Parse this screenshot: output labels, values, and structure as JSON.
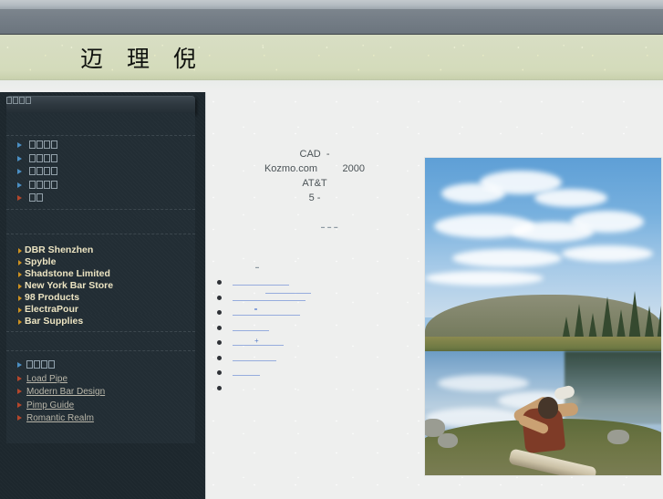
{
  "site": {
    "title": "迈 理 倪"
  },
  "sidebar": {
    "header_label_boxes": 4,
    "nav_top": [
      {
        "boxes": 4,
        "arrow": "blue"
      },
      {
        "boxes": 4,
        "arrow": "blue"
      },
      {
        "boxes": 4,
        "arrow": "blue"
      },
      {
        "boxes": 4,
        "arrow": "blue"
      },
      {
        "boxes": 2,
        "arrow": "red"
      }
    ],
    "brands": [
      "DBR Shenzhen",
      "Spyble",
      "Shadstone Limited",
      "New York Bar Store",
      "98 Products",
      "ElectraPour",
      "Bar Supplies"
    ],
    "links_header_boxes": 4,
    "links": [
      {
        "label": "",
        "boxes": 4,
        "arrow": "blue"
      },
      {
        "label": "Load Pipe",
        "boxes": 0,
        "arrow": "red"
      },
      {
        "label": "Modern Bar Design",
        "boxes": 0,
        "arrow": "red"
      },
      {
        "label": "Pimp Guide",
        "boxes": 0,
        "arrow": "red"
      },
      {
        "label": "Romantic Realm",
        "boxes": 0,
        "arrow": "red"
      }
    ]
  },
  "main": {
    "article_lines": [
      "CAD  -",
      "Kozmo.com         2000",
      "AT&T",
      "5 -"
    ],
    "ghost_line_1": "▬   ▬       ▬",
    "ghost_line_2": "▬",
    "link_rows": [
      {
        "widths": [
          62
        ],
        "offsets": [
          0
        ],
        "extra": null
      },
      {
        "widths": [
          80,
          50
        ],
        "offsets": [
          0,
          36
        ],
        "extra": null
      },
      {
        "widths": [
          74
        ],
        "offsets": [
          0
        ],
        "extra": "dot"
      },
      {
        "widths": [
          40
        ],
        "offsets": [
          0
        ],
        "extra": null
      },
      {
        "widths": [
          56
        ],
        "offsets": [
          0
        ],
        "extra": "plus"
      },
      {
        "widths": [
          48
        ],
        "offsets": [
          0
        ],
        "extra": null
      },
      {
        "widths": [
          30
        ],
        "offsets": [
          0
        ],
        "extra": null
      },
      {
        "widths": [
          0
        ],
        "offsets": [
          0
        ],
        "extra": null
      }
    ]
  },
  "photo": {
    "alt": "Lake with forest reflection and person relaxing on a log"
  },
  "colors": {
    "top_band": "#6c757e",
    "title_band": "#d5dcbd",
    "sidebar": "#1d272d",
    "panel": "#222d34",
    "brand_text": "#ece4c2",
    "link_blue": "#9fb0bc",
    "arrow_blue": "#4b8fc4",
    "arrow_red": "#b5472b",
    "arrow_gold": "#d0931f",
    "main_bg": "#eeefee",
    "main_link": "#6f8ed0"
  }
}
